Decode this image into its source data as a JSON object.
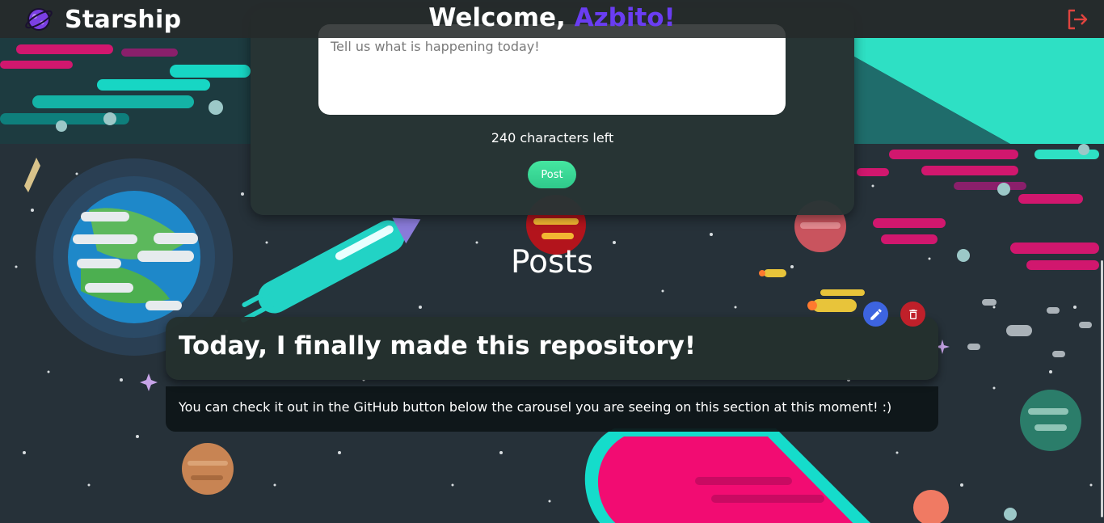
{
  "header": {
    "app_name": "Starship",
    "welcome_prefix": "Welcome, ",
    "username": "Azbito!",
    "logo_icon": "planet-logo-icon",
    "logout_icon": "logout-icon",
    "brand_accent": "#6a3df2",
    "logout_color": "#e0443f"
  },
  "composer": {
    "placeholder": "Tell us what is happening today!",
    "value": "",
    "char_counter": "240 characters left",
    "post_label": "Post",
    "post_color": "#3ad996"
  },
  "posts": {
    "heading": "Posts",
    "items": [
      {
        "title": "Today, I finally made this repository!",
        "body": "You can check it out in the GitHub button below the carousel you are seeing on this section at this moment! :)",
        "edit_icon": "pencil-icon",
        "delete_icon": "trash-icon"
      }
    ]
  },
  "colors": {
    "background": "#243038",
    "card": "#283434",
    "edit_button": "#3d64e0",
    "delete_button": "#c0202a"
  }
}
